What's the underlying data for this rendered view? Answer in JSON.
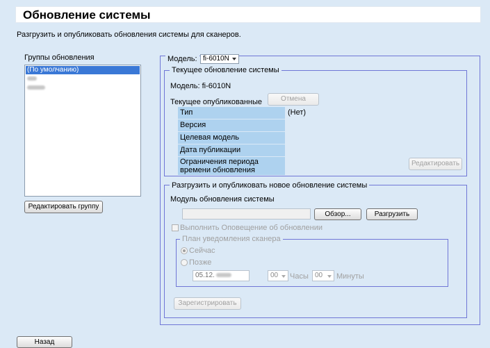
{
  "page": {
    "title": "Обновление системы",
    "description": "Разгрузить и опубликовать обновления системы для сканеров."
  },
  "groups": {
    "label": "Группы обновления",
    "items": [
      "(По умолчанию)"
    ],
    "edit_button": "Редактировать группу"
  },
  "model": {
    "label": "Модель:",
    "selected": "fi-6010N"
  },
  "current": {
    "legend": "Текущее обновление системы",
    "model_line": "Модель: fi-6010N",
    "published_label": "Текущее опубликованные",
    "cancel_button": "Отмена",
    "props": {
      "type": "Тип",
      "version": "Версия",
      "target_model": "Целевая модель",
      "publish_date": "Дата публикации",
      "limit_line1": "Ограничения периода",
      "limit_line2": "времени обновления"
    },
    "type_value": "(Нет)",
    "edit_button": "Редактировать"
  },
  "upload": {
    "legend": "Разгрузить и опубликовать новое обновление системы",
    "module_label": "Модуль обновления системы",
    "file_value": "",
    "browse_button": "Обзор...",
    "upload_button": "Разгрузить",
    "notify_label": "Выполнить Оповещение об обновлении",
    "register_button": "Зарегистрировать"
  },
  "plan": {
    "legend": "План уведомления сканера",
    "now_label": "Сейчас",
    "later_label": "Позже",
    "date_value": "05.12.",
    "hours_value": "00",
    "hours_label": "Часы",
    "minutes_value": "00",
    "minutes_label": "Минуты"
  },
  "back_button": "Назад"
}
